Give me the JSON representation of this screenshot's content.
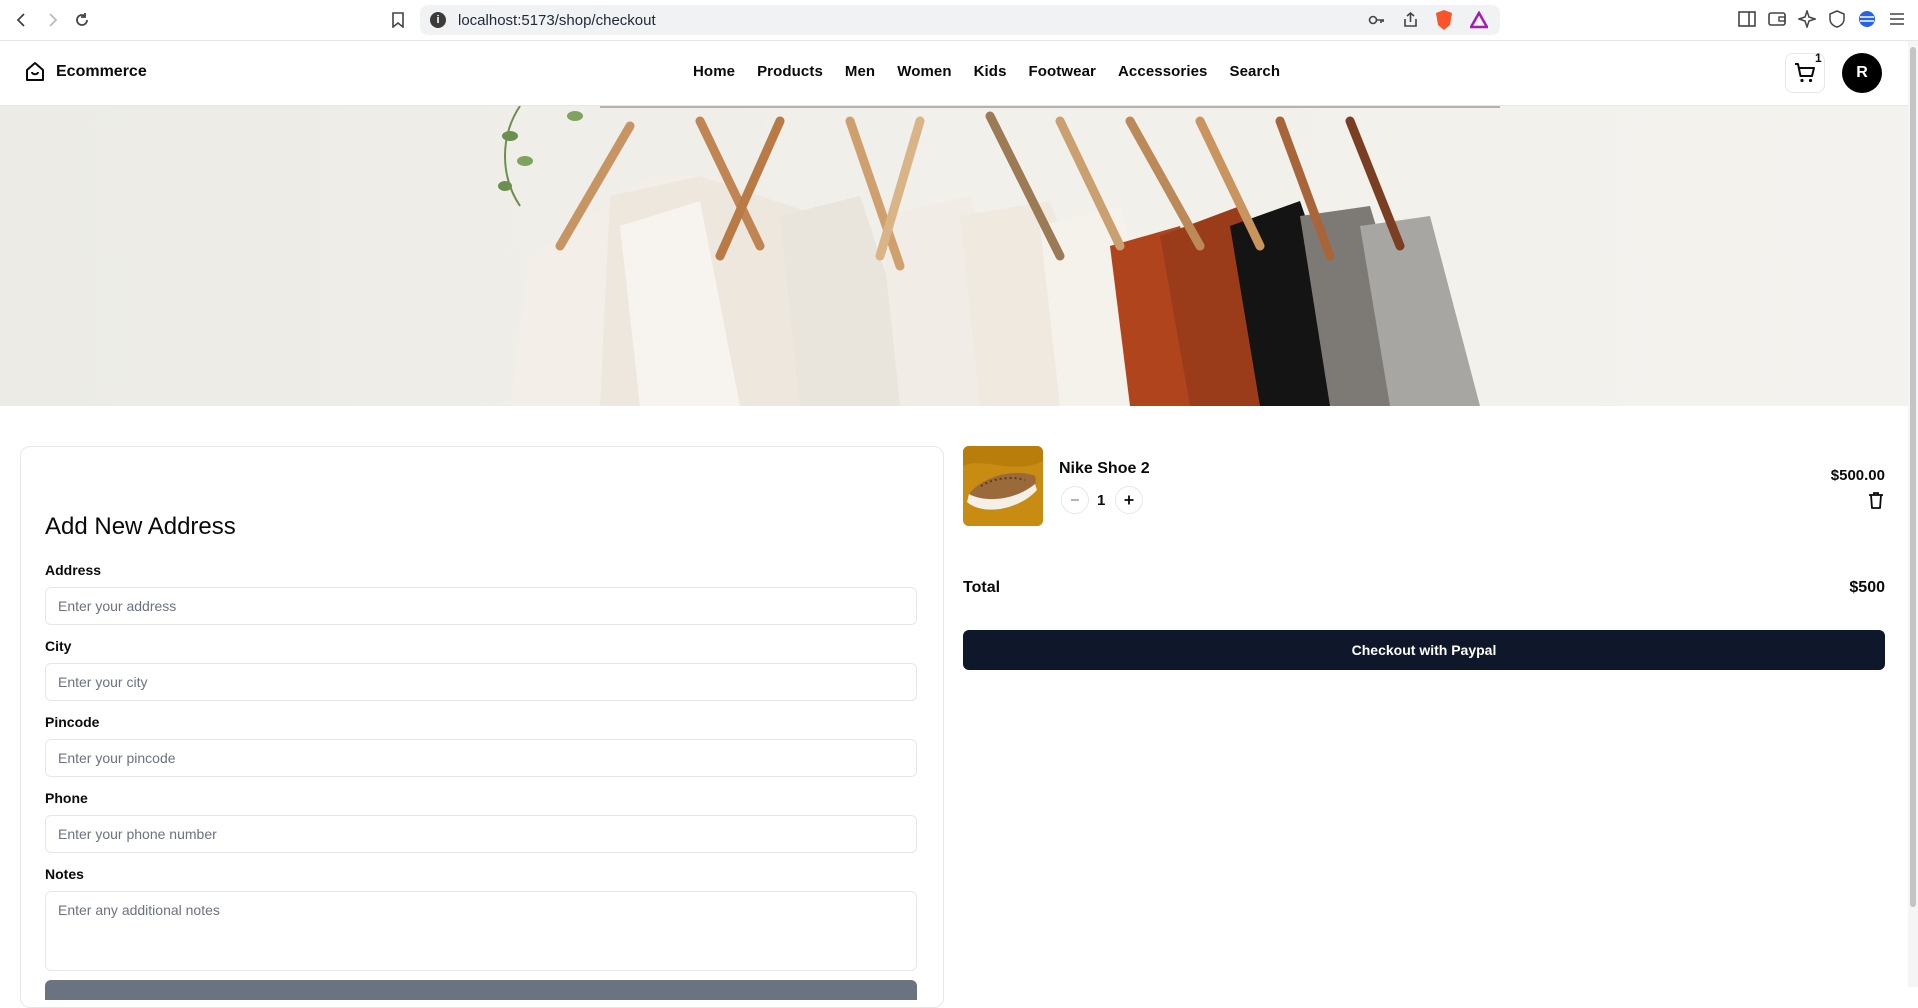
{
  "browser": {
    "url": "localhost:5173/shop/checkout"
  },
  "header": {
    "brand": "Ecommerce",
    "nav": [
      "Home",
      "Products",
      "Men",
      "Women",
      "Kids",
      "Footwear",
      "Accessories",
      "Search"
    ],
    "cart_count": "1",
    "avatar_initial": "R"
  },
  "address_form": {
    "title": "Add New Address",
    "fields": [
      {
        "label": "Address",
        "placeholder": "Enter your address"
      },
      {
        "label": "City",
        "placeholder": "Enter your city"
      },
      {
        "label": "Pincode",
        "placeholder": "Enter your pincode"
      },
      {
        "label": "Phone",
        "placeholder": "Enter your phone number"
      },
      {
        "label": "Notes",
        "placeholder": "Enter any additional notes"
      }
    ]
  },
  "cart": {
    "items": [
      {
        "title": "Nike Shoe 2",
        "quantity": "1",
        "price": "$500.00"
      }
    ],
    "total_label": "Total",
    "total_value": "$500",
    "checkout_label": "Checkout with Paypal"
  },
  "colors": {
    "primary": "#0f172a",
    "border": "#e5e7eb",
    "muted_text": "#6b7280"
  }
}
